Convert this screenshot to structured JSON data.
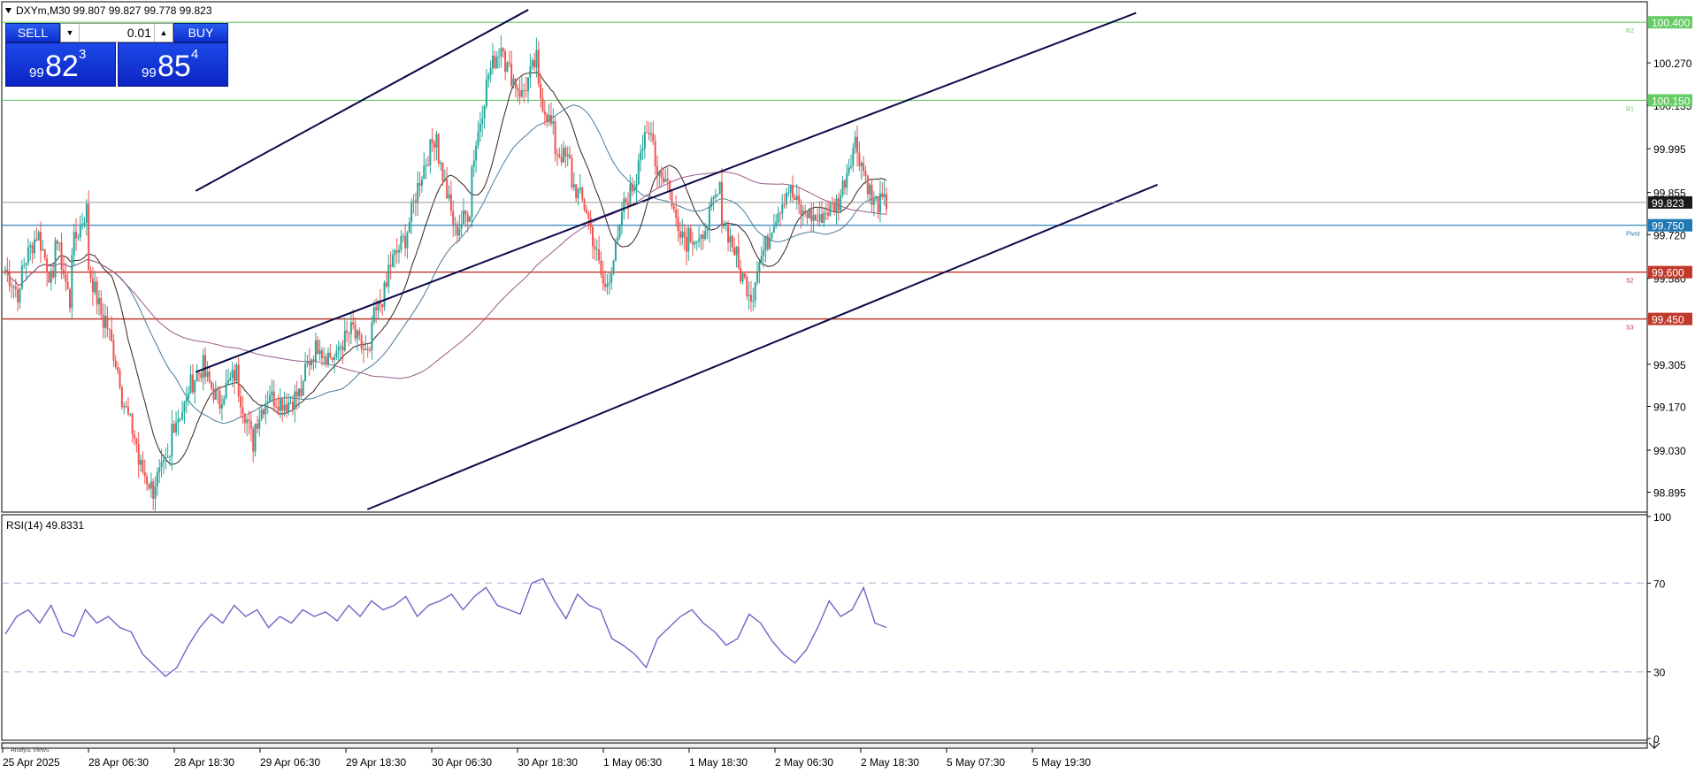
{
  "header": {
    "symbol_line": "DXYm,M30  99.807 99.827 99.778 99.823"
  },
  "trade_panel": {
    "sell_label": "SELL",
    "buy_label": "BUY",
    "lot": "0.01",
    "sell_price_prefix": "99",
    "sell_price_main": "82",
    "sell_price_sup": "3",
    "buy_price_prefix": "99",
    "buy_price_main": "85",
    "buy_price_sup": "4"
  },
  "indicator": {
    "label": "RSI(14) 49.8331"
  },
  "footer": {
    "tab_label": "Analyst Views"
  },
  "colors": {
    "bull": "#26a69a",
    "bear": "#ef5350",
    "channel": "#0a0a4a",
    "resistance": "#66cc66",
    "pivot": "#1f77b4",
    "support": "#c0392b",
    "rsi": "#7b5ec6"
  },
  "chart_data": [
    {
      "type": "candlestick",
      "title": "DXYm,M30  99.807 99.827 99.778 99.823",
      "ylim": [
        98.84,
        100.46
      ],
      "y_ticks": [
        "100.270",
        "100.135",
        "99.995",
        "99.855",
        "99.720",
        "99.580",
        "99.305",
        "99.170",
        "99.030",
        "98.895"
      ],
      "x_ticks": [
        "25 Apr 2025",
        "28 Apr 06:30",
        "28 Apr 18:30",
        "29 Apr 06:30",
        "29 Apr 18:30",
        "30 Apr 06:30",
        "30 Apr 18:30",
        "1 May 06:30",
        "1 May 18:30",
        "2 May 06:30",
        "2 May 18:30",
        "5 May 07:30",
        "5 May 19:30"
      ],
      "current_price": "99.823",
      "levels": [
        {
          "name": "R2",
          "value": "100.400",
          "kind": "resistance"
        },
        {
          "name": "R1",
          "value": "100.150",
          "kind": "resistance"
        },
        {
          "name": "Pivot",
          "value": "99.750",
          "kind": "pivot"
        },
        {
          "name": "S2",
          "value": "99.600",
          "kind": "support"
        },
        {
          "name": "S3",
          "value": "99.450",
          "kind": "support"
        }
      ],
      "channel_lines": [
        {
          "from": [
            "28 Apr 21:30",
            99.86
          ],
          "to": [
            "30 Apr 20:00",
            100.44
          ]
        },
        {
          "from": [
            "28 Apr 21:30",
            99.28
          ],
          "to": [
            "6 May 09:00",
            100.43
          ]
        },
        {
          "from": [
            "29 Apr 21:30",
            98.84
          ],
          "to": [
            "6 May 12:00",
            99.88
          ]
        }
      ],
      "price_path": [
        [
          99.62,
          99.52
        ],
        [
          99.6,
          99.72
        ],
        [
          99.74,
          99.55
        ],
        [
          99.76,
          99.5
        ],
        [
          99.66,
          99.8
        ],
        [
          99.64,
          99.44
        ],
        [
          99.48,
          99.26
        ],
        [
          99.22,
          99.05
        ],
        [
          99.0,
          98.9
        ],
        [
          98.92,
          99.0
        ],
        [
          99.1,
          99.18
        ],
        [
          99.22,
          99.3
        ],
        [
          99.28,
          99.18
        ],
        [
          99.2,
          99.28
        ],
        [
          99.25,
          99.05
        ],
        [
          99.1,
          99.22
        ],
        [
          99.2,
          99.18
        ],
        [
          99.18,
          99.22
        ],
        [
          99.28,
          99.38
        ],
        [
          99.35,
          99.32
        ],
        [
          99.35,
          99.42
        ],
        [
          99.4,
          99.32
        ],
        [
          99.42,
          99.55
        ],
        [
          99.6,
          99.7
        ],
        [
          99.68,
          99.9
        ],
        [
          99.9,
          100.05
        ],
        [
          100.0,
          99.76
        ],
        [
          99.72,
          99.8
        ],
        [
          99.9,
          100.2
        ],
        [
          100.22,
          100.34
        ],
        [
          100.28,
          100.18
        ],
        [
          100.15,
          100.28
        ],
        [
          100.2,
          100.05
        ],
        [
          100.0,
          99.95
        ],
        [
          99.9,
          99.8
        ],
        [
          99.8,
          99.56
        ],
        [
          99.52,
          99.72
        ],
        [
          99.78,
          99.9
        ],
        [
          99.98,
          100.05
        ],
        [
          99.95,
          99.88
        ],
        [
          99.82,
          99.7
        ],
        [
          99.74,
          99.68
        ],
        [
          99.74,
          99.86
        ],
        [
          99.8,
          99.65
        ],
        [
          99.62,
          99.52
        ],
        [
          99.58,
          99.72
        ],
        [
          99.74,
          99.86
        ],
        [
          99.88,
          99.78
        ],
        [
          99.8,
          99.76
        ],
        [
          99.78,
          99.82
        ],
        [
          99.8,
          100.0
        ],
        [
          100.04,
          99.86
        ],
        [
          99.82,
          99.82
        ]
      ]
    },
    {
      "type": "line",
      "title": "RSI(14) 49.8331",
      "ylim": [
        0,
        100
      ],
      "y_ticks": [
        "100",
        "70",
        "30",
        "0"
      ],
      "levels": [
        70,
        30
      ],
      "values": [
        47,
        55,
        58,
        52,
        60,
        48,
        46,
        58,
        52,
        55,
        50,
        48,
        38,
        33,
        28,
        32,
        42,
        50,
        56,
        52,
        60,
        55,
        58,
        50,
        55,
        52,
        58,
        55,
        57,
        53,
        60,
        55,
        62,
        58,
        60,
        64,
        55,
        60,
        62,
        65,
        58,
        64,
        68,
        60,
        58,
        56,
        70,
        72,
        62,
        54,
        65,
        60,
        58,
        45,
        42,
        38,
        32,
        45,
        50,
        55,
        58,
        52,
        48,
        42,
        45,
        56,
        52,
        44,
        38,
        34,
        40,
        50,
        62,
        55,
        58,
        68,
        52,
        50
      ]
    }
  ]
}
